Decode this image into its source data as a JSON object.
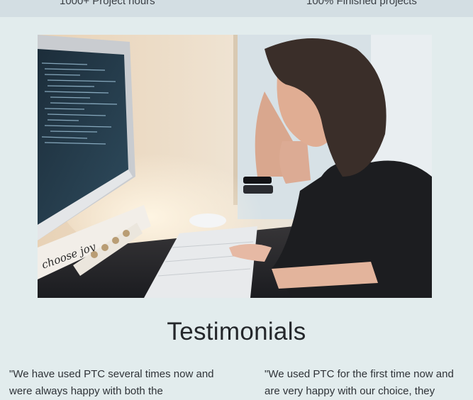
{
  "stats": {
    "project_hours": "1000+ Project hours",
    "finished_projects": "100% Finished projects"
  },
  "hero": {
    "alt": "Woman working at a computer with code on screen",
    "sticker_text": "choose joy"
  },
  "testimonials": {
    "title": "Testimonials",
    "items": [
      {
        "text": "\"We have used PTC several times now and were always happy with both the"
      },
      {
        "text": "\"We used PTC for the first time now and are very happy with our choice, they"
      }
    ]
  }
}
